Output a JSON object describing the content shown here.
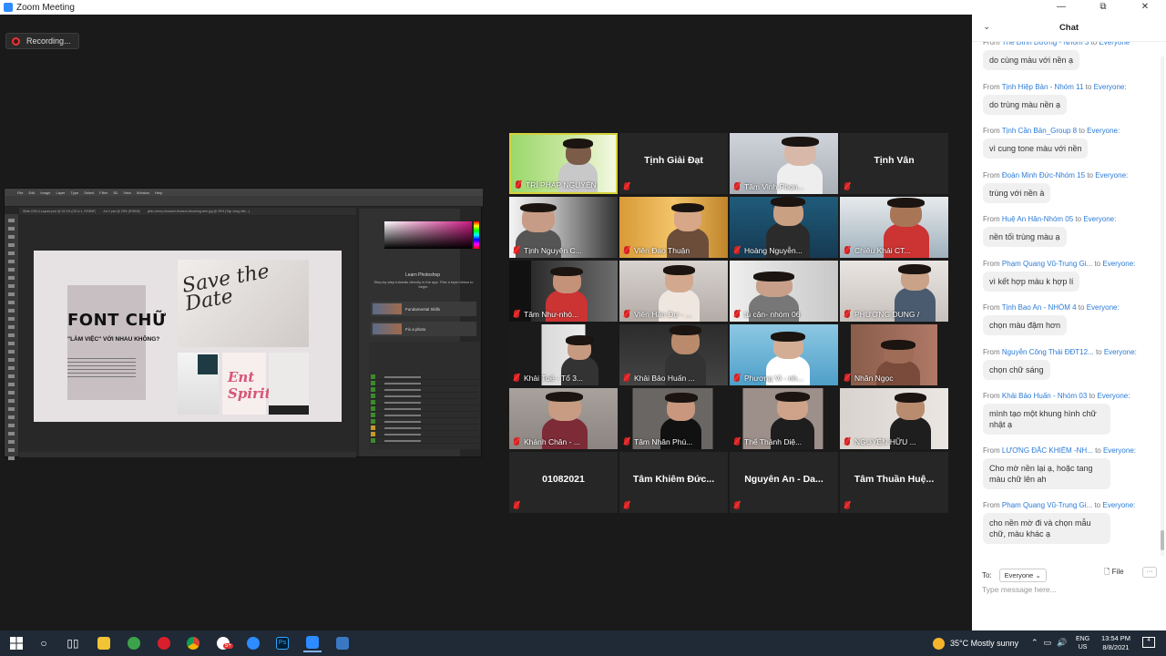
{
  "window": {
    "title": "Zoom Meeting",
    "minimize": "—",
    "restore": "⧉",
    "close": "✕"
  },
  "recording": {
    "label": "Recording..."
  },
  "photoshop": {
    "menu": [
      "File",
      "Edit",
      "Image",
      "Layer",
      "Type",
      "Select",
      "Filter",
      "3D",
      "View",
      "Window",
      "Help"
    ],
    "tabs": [
      "Slide-CE6.4-Layout.psd @ 33.3% (CE-6.1, RGB/8*)",
      "Art 2.psd @ 25% (RGB/8)",
      "pink-cherry-blossom-flowers-blooming-tree.jpg @ 25% (Tập công việc...)"
    ],
    "doc_title": "FONT CHỮ",
    "doc_subtitle": "\"LÀM VIỆC\" VỚI NHAU KHÔNG?",
    "script_text": "Save the Date",
    "pink_script": "Ent Spirit",
    "learn_title": "Learn Photoshop",
    "learn_text": "Step-by-step tutorials directly in the app. Pick a topic below to begin.",
    "cards": [
      "Fundamental Skills",
      "Fix a photo"
    ]
  },
  "participants": [
    {
      "name": "TRÍ PHÁP NGUYỄN",
      "video": true,
      "active": true
    },
    {
      "name": "Tịnh Giải Đạt",
      "video": false
    },
    {
      "name": "Tâm Vinh Phon...",
      "video": true
    },
    {
      "name": "Tịnh Vân",
      "video": false
    },
    {
      "name": "Tịnh Nguyên C...",
      "video": true
    },
    {
      "name": "Viên Đạo Thuận",
      "video": true
    },
    {
      "name": "Hoàng Nguyễn...",
      "video": true
    },
    {
      "name": "Chiêu Khải CT...",
      "video": true
    },
    {
      "name": "Tâm Như-nhó...",
      "video": true
    },
    {
      "name": "Viên Hân Dự - ...",
      "video": true
    },
    {
      "name": "tủ cận- nhóm 06",
      "video": true
    },
    {
      "name": "PHƯƠNG DUNG /",
      "video": true
    },
    {
      "name": "Khải Tuệ - Tổ 3...",
      "video": true
    },
    {
      "name": "Khải Bảo Huấn ...",
      "video": true
    },
    {
      "name": "Phương Vi - nh...",
      "video": true
    },
    {
      "name": "Nhân Ngọc",
      "video": true
    },
    {
      "name": "Khánh Chân - ...",
      "video": true
    },
    {
      "name": "Tâm Nhân Phú...",
      "video": true
    },
    {
      "name": "Thể Thánh Diệ...",
      "video": true
    },
    {
      "name": "NGUYỄN HỮU ...",
      "video": true
    },
    {
      "name": "01082021",
      "video": false
    },
    {
      "name": "Tâm Khiêm Đức...",
      "video": false
    },
    {
      "name": "Nguyên An - Da...",
      "video": false
    },
    {
      "name": "Tâm Thuần Huệ...",
      "video": false
    }
  ],
  "chat": {
    "title": "Chat",
    "collapse": "⌄",
    "from_word": "From",
    "to_word": "to",
    "messages": [
      {
        "sender": "The Đình Dương - Nhóm 3",
        "to": "Everyone",
        "text": "do cùng màu với nền ạ"
      },
      {
        "sender": "Tịnh Hiệp Bản - Nhóm 11",
        "to": "Everyone:",
        "text": "do trùng màu nền ạ"
      },
      {
        "sender": "Tịnh Cần Bản_Group 8",
        "to": "Everyone:",
        "text": "vì cung tone màu với nền"
      },
      {
        "sender": "Đoàn Minh Đức-Nhóm 15",
        "to": "Everyone:",
        "text": "trùng với nền à"
      },
      {
        "sender": "Huệ An Hân-Nhóm 05",
        "to": "Everyone:",
        "text": "nền tối trùng màu ạ"
      },
      {
        "sender": "Phạm Quang Vũ-Trung Gi...",
        "to": "Everyone:",
        "text": "vì kết hợp màu k hợp lí"
      },
      {
        "sender": "Tịnh Bao An - NHÓM 4",
        "to": "Everyone:",
        "text": "chọn màu đậm hơn"
      },
      {
        "sender": "Nguyễn Công Thái ĐĐT12...",
        "to": "Everyone:",
        "text": "chọn chữ sáng"
      },
      {
        "sender": "Khải Bảo Huấn - Nhóm 03",
        "to": "Everyone:",
        "text": "mình tạo một khung hình chữ nhật ạ"
      },
      {
        "sender": "LƯƠNG ĐẮC KHIÊM -NH...",
        "to": "Everyone:",
        "text": "Cho mờ nền lại ạ, hoặc tang màu chữ lên ah"
      },
      {
        "sender": "Phạm Quang Vũ-Trung Gi...",
        "to": "Everyone:",
        "text": "cho nền mờ đi và chọn mẫu chữ, màu khác ạ"
      }
    ],
    "to_label": "To:",
    "recipient": "Everyone",
    "file_label": "File",
    "more_label": "···",
    "input_placeholder": "Type message here..."
  },
  "taskbar": {
    "weather": "35°C  Mostly sunny",
    "lang": "ENG",
    "region": "US",
    "time": "13:54 PM",
    "date": "8/8/2021",
    "notif_count": "4",
    "badge": "5+"
  }
}
